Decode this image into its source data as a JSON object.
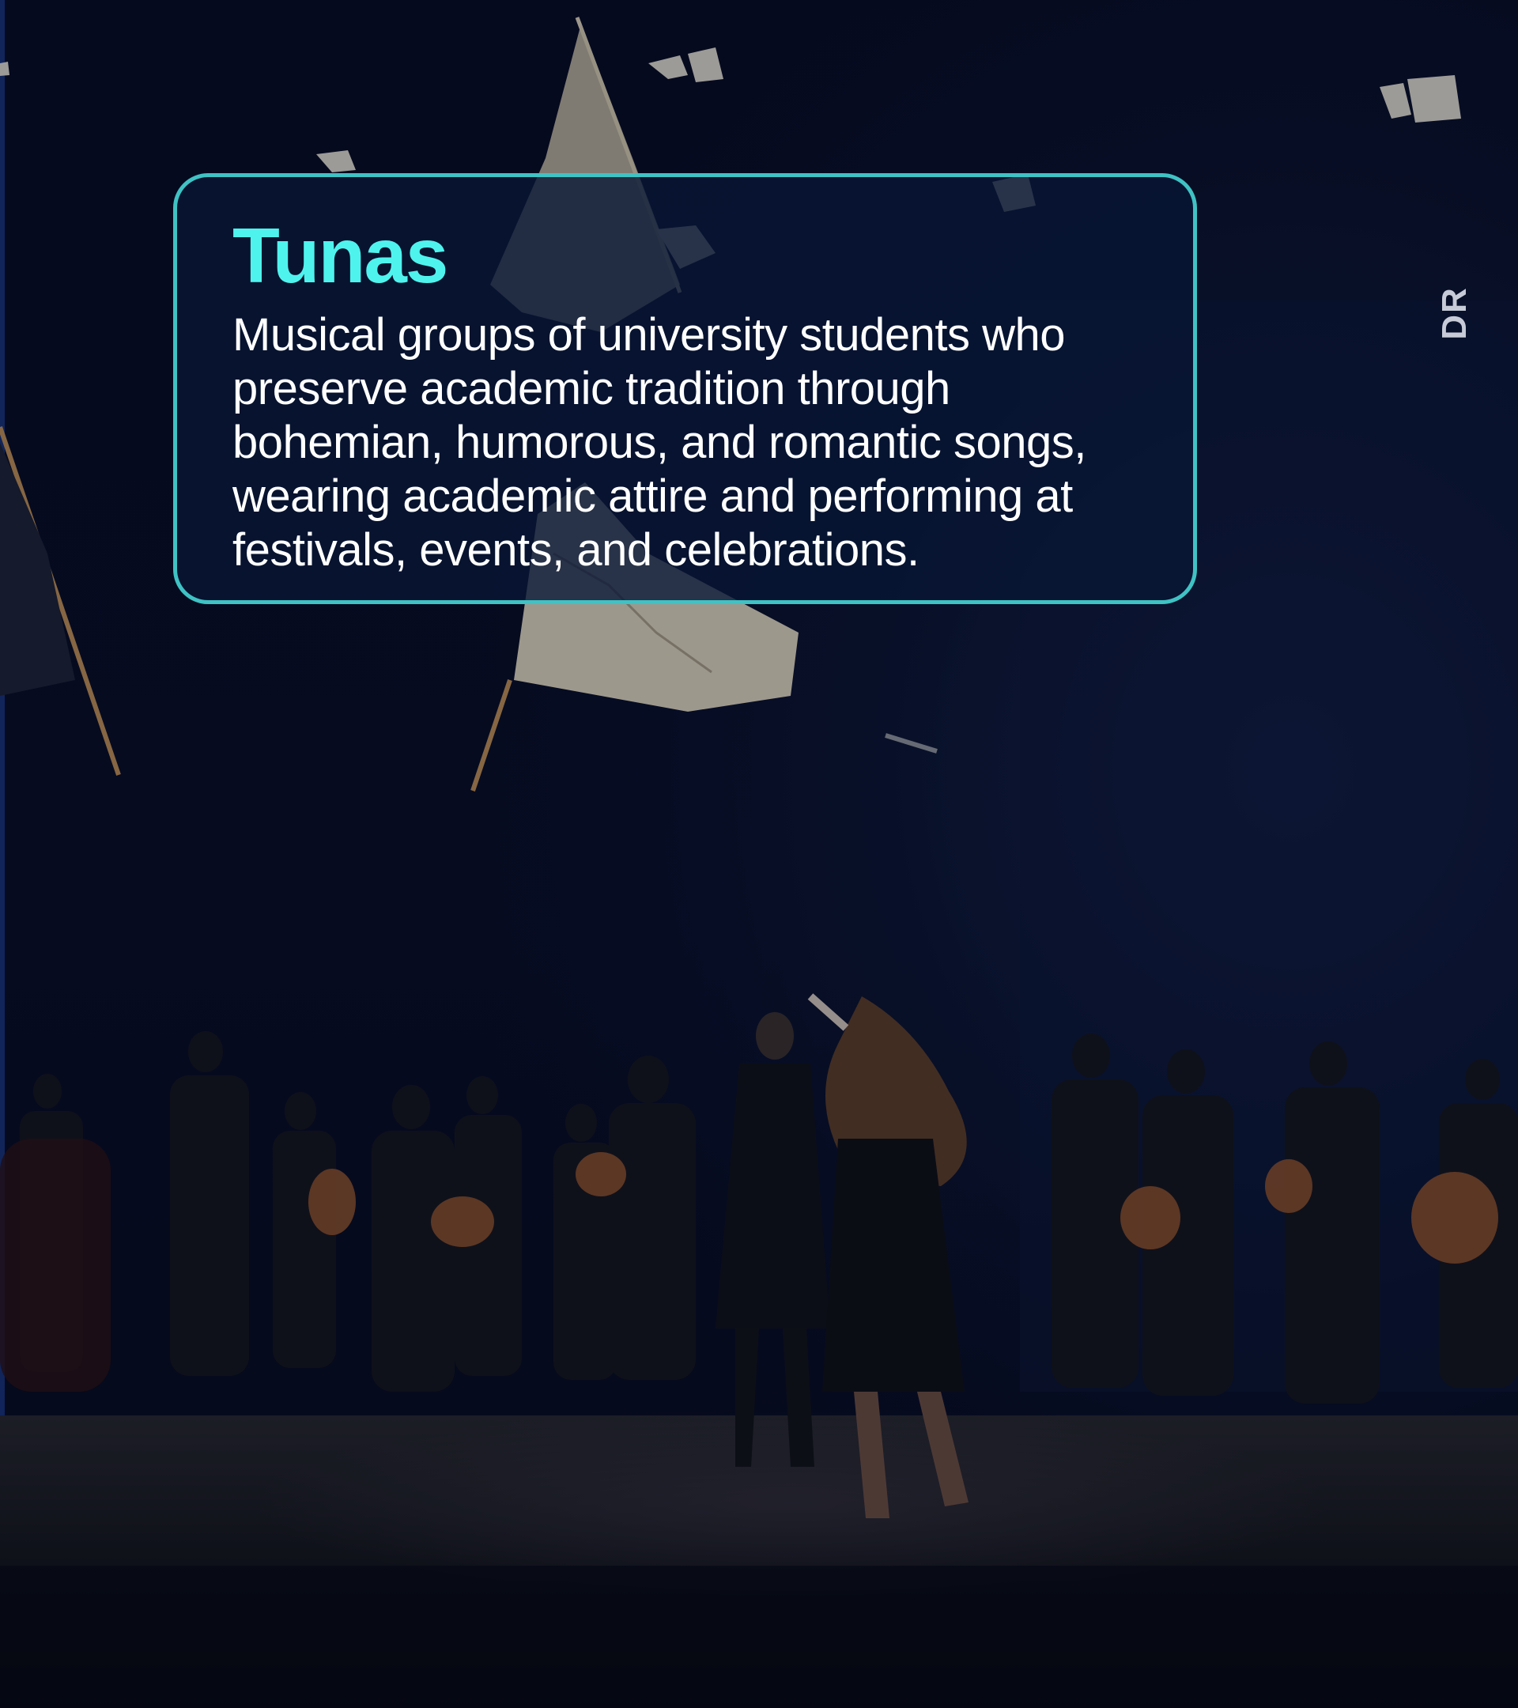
{
  "card": {
    "title": "Tunas",
    "description": "Musical groups of university students who preserve academic tradition through bohemian, humorous, and romantic songs, wearing academic attire and performing at festivals, events, and celebrations."
  },
  "photo_credit": "DR",
  "colors": {
    "background": "#070d22",
    "accent": "#4ff3ee",
    "card_border": "#3fc2c4",
    "text": "#ffffff"
  }
}
